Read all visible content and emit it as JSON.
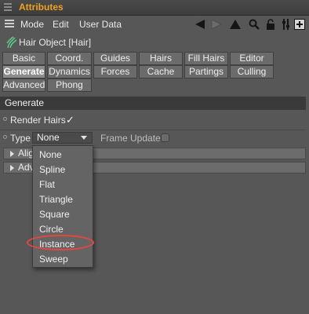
{
  "window": {
    "title": "Attributes"
  },
  "menubar": {
    "items": [
      "Mode",
      "Edit",
      "User Data"
    ]
  },
  "toolbar": {
    "icons": [
      "arrow-left-icon",
      "arrow-right-icon",
      "arrow-up-icon",
      "search-icon",
      "lock-icon",
      "settings-icon",
      "new-panel-icon"
    ]
  },
  "object": {
    "name": "Hair Object [Hair]"
  },
  "tabs": {
    "row1": [
      "Basic",
      "Coord.",
      "Guides",
      "Hairs",
      "Fill Hairs",
      "Editor"
    ],
    "row2": [
      "Generate",
      "Dynamics",
      "Forces",
      "Cache",
      "Partings",
      "Culling"
    ],
    "row3": [
      "Advanced",
      "Phong"
    ],
    "active": "Generate"
  },
  "section": {
    "title": "Generate"
  },
  "properties": {
    "render_hairs": {
      "label": "Render Hairs",
      "checked": true,
      "check_mark": "✓"
    },
    "type": {
      "label": "Type",
      "value": "None"
    },
    "frame_update": {
      "label": "Frame Update",
      "checked": false
    }
  },
  "groups": {
    "align": {
      "label": "Alig"
    },
    "advanced": {
      "label": "Adv"
    }
  },
  "dropdown": {
    "options": [
      "None",
      "Spline",
      "Flat",
      "Triangle",
      "Square",
      "Circle",
      "Instance",
      "Sweep"
    ],
    "highlighted": "Instance"
  },
  "colors": {
    "title": "#f0a11e",
    "highlight_ring": "#e8463c",
    "accent": "#3d8fd6"
  }
}
